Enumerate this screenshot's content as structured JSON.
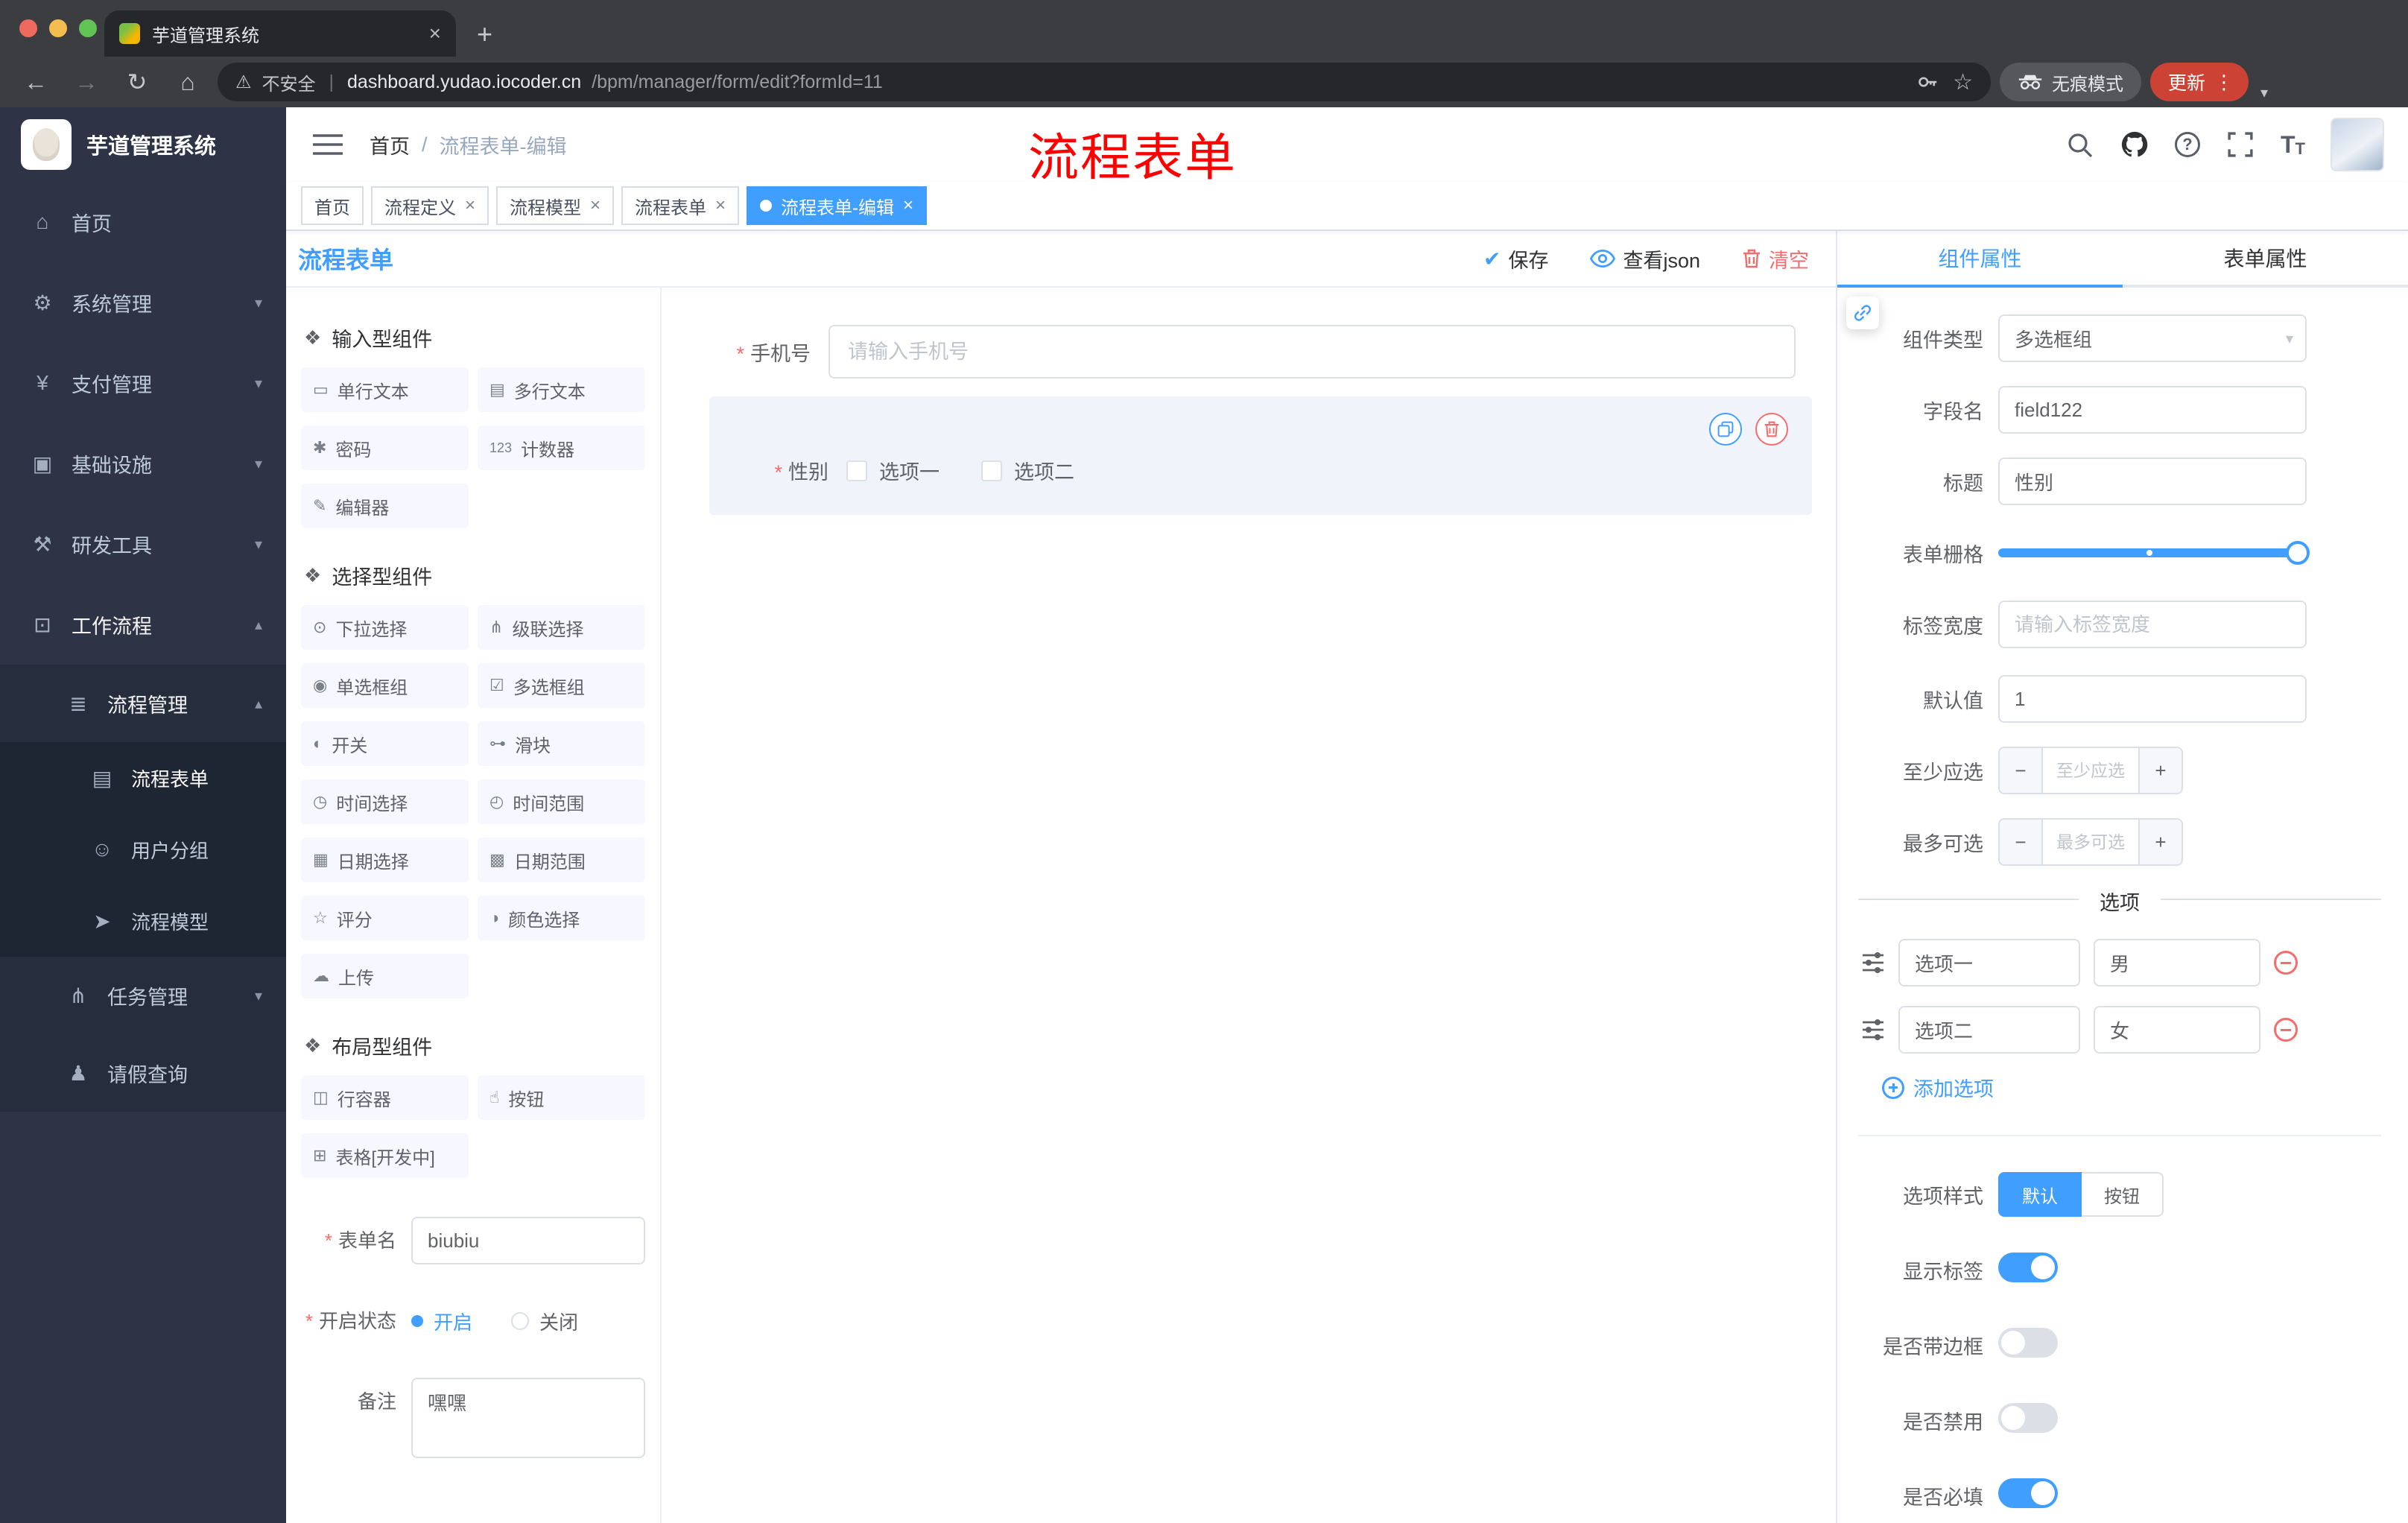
{
  "browser": {
    "tab_title": "芋道管理系统",
    "security_label": "不安全",
    "url_host": "dashboard.yudao.iocoder.cn",
    "url_path": "/bpm/manager/form/edit?formId=11",
    "incognito_label": "无痕模式",
    "update_label": "更新"
  },
  "icons": {
    "back": "←",
    "forward": "→",
    "reload": "↻",
    "home": "⌂",
    "warning": "⚠",
    "star": "☆",
    "dots": "⋮",
    "close": "×",
    "plus": "+",
    "minus": "−",
    "check": "✔",
    "caret_down": "▾",
    "caret_up": "▴"
  },
  "sidebar": {
    "app_title": "芋道管理系统",
    "menu": [
      {
        "label": "首页",
        "icon": "⌂"
      },
      {
        "label": "系统管理",
        "icon": "⚙"
      },
      {
        "label": "支付管理",
        "icon": "¥"
      },
      {
        "label": "基础设施",
        "icon": "▣"
      },
      {
        "label": "研发工具",
        "icon": "⚒"
      },
      {
        "label": "工作流程",
        "icon": "⊡"
      }
    ],
    "level2": [
      {
        "label": "流程管理",
        "icon": "≣"
      },
      {
        "label": "任务管理",
        "icon": "⋔"
      },
      {
        "label": "请假查询",
        "icon": "♟"
      }
    ],
    "level3": [
      {
        "label": "流程表单",
        "icon": "▤"
      },
      {
        "label": "用户分组",
        "icon": "☺"
      },
      {
        "label": "流程模型",
        "icon": "➤"
      }
    ]
  },
  "header": {
    "breadcrumb_home": "首页",
    "breadcrumb_separator": "/",
    "breadcrumb_current": "流程表单-编辑",
    "annotation": "流程表单"
  },
  "tags": [
    {
      "label": "首页"
    },
    {
      "label": "流程定义"
    },
    {
      "label": "流程模型"
    },
    {
      "label": "流程表单"
    },
    {
      "label": "流程表单-编辑"
    }
  ],
  "designer": {
    "panel_title": "流程表单",
    "actions": {
      "save": "保存",
      "view_json": "查看json",
      "clear": "清空"
    },
    "palette": {
      "input_section": "输入型组件",
      "input_items": [
        {
          "label": "单行文本",
          "icon": "▭"
        },
        {
          "label": "多行文本",
          "icon": "▤"
        },
        {
          "label": "密码",
          "icon": "✱"
        },
        {
          "label": "计数器",
          "icon": "123"
        },
        {
          "label": "编辑器",
          "icon": "✎"
        }
      ],
      "select_section": "选择型组件",
      "select_items": [
        {
          "label": "下拉选择",
          "icon": "⊙"
        },
        {
          "label": "级联选择",
          "icon": "⋔"
        },
        {
          "label": "单选框组",
          "icon": "◉"
        },
        {
          "label": "多选框组",
          "icon": "☑"
        },
        {
          "label": "开关",
          "icon": "◐"
        },
        {
          "label": "滑块",
          "icon": "⊶"
        },
        {
          "label": "时间选择",
          "icon": "◷"
        },
        {
          "label": "时间范围",
          "icon": "◴"
        },
        {
          "label": "日期选择",
          "icon": "▦"
        },
        {
          "label": "日期范围",
          "icon": "▩"
        },
        {
          "label": "评分",
          "icon": "☆"
        },
        {
          "label": "颜色选择",
          "icon": "◑"
        },
        {
          "label": "上传",
          "icon": "☁"
        }
      ],
      "layout_section": "布局型组件",
      "layout_items": [
        {
          "label": "行容器",
          "icon": "◫"
        },
        {
          "label": "按钮",
          "icon": "☝"
        },
        {
          "label": "表格[开发中]",
          "icon": "⊞"
        }
      ]
    },
    "meta": {
      "name_label": "表单名",
      "name_value": "biubiu",
      "status_label": "开启状态",
      "status_on": "开启",
      "status_off": "关闭",
      "remark_label": "备注",
      "remark_value": "嘿嘿"
    },
    "canvas": {
      "phone_label": "手机号",
      "phone_placeholder": "请输入手机号",
      "gender_label": "性别",
      "gender_option1": "选项一",
      "gender_option2": "选项二"
    }
  },
  "props": {
    "tab_component": "组件属性",
    "tab_form": "表单属性",
    "component_type_label": "组件类型",
    "component_type_value": "多选框组",
    "field_name_label": "字段名",
    "field_name_value": "field122",
    "title_label": "标题",
    "title_value": "性别",
    "grid_label": "表单栅格",
    "label_width_label": "标签宽度",
    "label_width_placeholder": "请输入标签宽度",
    "default_label": "默认值",
    "default_value": "1",
    "min_label": "至少应选",
    "min_placeholder": "至少应选",
    "max_label": "最多可选",
    "max_placeholder": "最多可选",
    "options_divider": "选项",
    "options": [
      {
        "label": "选项一",
        "value": "男"
      },
      {
        "label": "选项二",
        "value": "女"
      }
    ],
    "add_option_label": "添加选项",
    "option_style_label": "选项样式",
    "option_style_default": "默认",
    "option_style_button": "按钮",
    "show_label_label": "显示标签",
    "border_label": "是否带边框",
    "disabled_label": "是否禁用",
    "required_label": "是否必填"
  },
  "colors": {
    "accent": "#409eff",
    "danger": "#f56c6c",
    "annotation_red": "#fb0200",
    "sidebar_bg": "#2e3446"
  }
}
